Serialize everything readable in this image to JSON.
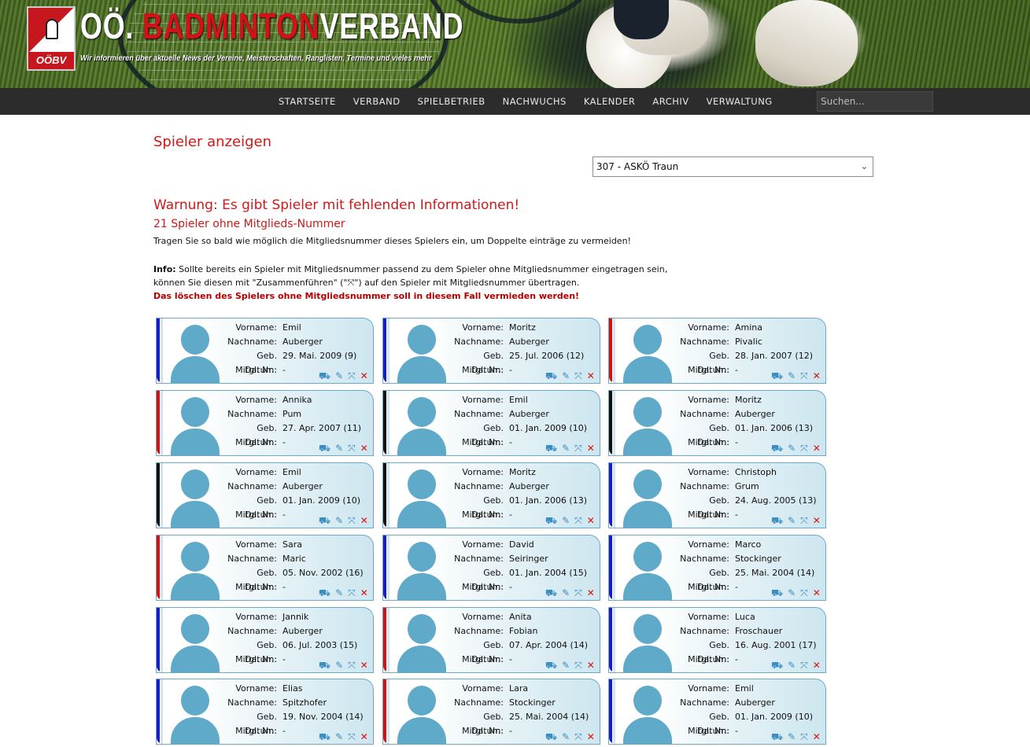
{
  "header": {
    "logo_text": "OÖBV",
    "brand_part1": "OÖ.",
    "brand_part2": "BADMINTON",
    "brand_part3": "VERBAND",
    "tagline": "Wir informieren über aktuelle News der Vereine, Meisterschaften, Ranglisten, Termine und vieles mehr"
  },
  "nav": {
    "items": [
      "STARTSEITE",
      "VERBAND",
      "SPIELBETRIEB",
      "NACHWUCHS",
      "KALENDER",
      "ARCHIV",
      "VERWALTUNG"
    ],
    "search_placeholder": "Suchen..."
  },
  "page": {
    "title": "Spieler anzeigen",
    "club_select": "307 - ASKÖ Traun",
    "warning": "Warnung: Es gibt Spieler mit fehlenden Informationen!",
    "subheading": "21 Spieler ohne Mitglieds-Nummer",
    "hint": "Tragen Sie so bald wie möglich die Mitgliedsnummer dieses Spielers ein, um Doppelte einträge zu vermeiden!",
    "info_label": "Info:",
    "info_line1": " Sollte bereits ein Spieler mit Mitgliedsnummer passend zu dem Spieler ohne Mitgliedsnummer eingetragen sein,",
    "info_line2a": "können Sie diesen mit \"Zusammenführen\" (\"",
    "info_icon": "⤧",
    "info_line2b": "\") auf den Spieler mit Mitgliedsnummer übertragen.",
    "info_warn": "Das löschen des Spielers ohne Mitgliedsnummer soll in diesem Fall vermieden werden!"
  },
  "labels": {
    "vorname": "Vorname:",
    "nachname": "Nachname:",
    "geb": "Geb. Datum:",
    "mitgl": "Mitgl. Nr.:"
  },
  "colors": {
    "male": "#1a1acc",
    "female": "#d41010",
    "unknown": "#111111",
    "accent": "#cc1919"
  },
  "players": [
    {
      "vorname": "Emil",
      "nachname": "Auberger",
      "geb": "29. Mai. 2009 (9)",
      "mitgl": "-",
      "gender": "male"
    },
    {
      "vorname": "Moritz",
      "nachname": "Auberger",
      "geb": "25. Jul. 2006 (12)",
      "mitgl": "-",
      "gender": "male"
    },
    {
      "vorname": "Amina",
      "nachname": "Pivalic",
      "geb": "28. Jan. 2007 (12)",
      "mitgl": "-",
      "gender": "female"
    },
    {
      "vorname": "Annika",
      "nachname": "Pum",
      "geb": "27. Apr. 2007 (11)",
      "mitgl": "-",
      "gender": "female"
    },
    {
      "vorname": "Emil",
      "nachname": "Auberger",
      "geb": "01. Jan. 2009 (10)",
      "mitgl": "-",
      "gender": "unknown"
    },
    {
      "vorname": "Moritz",
      "nachname": "Auberger",
      "geb": "01. Jan. 2006 (13)",
      "mitgl": "-",
      "gender": "unknown"
    },
    {
      "vorname": "Emil",
      "nachname": "Auberger",
      "geb": "01. Jan. 2009 (10)",
      "mitgl": "-",
      "gender": "unknown"
    },
    {
      "vorname": "Moritz",
      "nachname": "Auberger",
      "geb": "01. Jan. 2006 (13)",
      "mitgl": "-",
      "gender": "unknown"
    },
    {
      "vorname": "Christoph",
      "nachname": "Grum",
      "geb": "24. Aug. 2005 (13)",
      "mitgl": "-",
      "gender": "male"
    },
    {
      "vorname": "Sara",
      "nachname": "Maric",
      "geb": "05. Nov. 2002 (16)",
      "mitgl": "-",
      "gender": "female"
    },
    {
      "vorname": "David",
      "nachname": "Seiringer",
      "geb": "01. Jan. 2004 (15)",
      "mitgl": "-",
      "gender": "male"
    },
    {
      "vorname": "Marco",
      "nachname": "Stockinger",
      "geb": "25. Mai. 2004 (14)",
      "mitgl": "-",
      "gender": "male"
    },
    {
      "vorname": "Jannik",
      "nachname": "Auberger",
      "geb": "06. Jul. 2003 (15)",
      "mitgl": "-",
      "gender": "male"
    },
    {
      "vorname": "Anita",
      "nachname": "Fobian",
      "geb": "07. Apr. 2004 (14)",
      "mitgl": "-",
      "gender": "female"
    },
    {
      "vorname": "Luca",
      "nachname": "Froschauer",
      "geb": "16. Aug. 2001 (17)",
      "mitgl": "-",
      "gender": "male"
    },
    {
      "vorname": "Elias",
      "nachname": "Spitzhofer",
      "geb": "19. Nov. 2004 (14)",
      "mitgl": "-",
      "gender": "male"
    },
    {
      "vorname": "Lara",
      "nachname": "Stockinger",
      "geb": "25. Mai. 2004 (14)",
      "mitgl": "-",
      "gender": "female"
    },
    {
      "vorname": "Emil",
      "nachname": "Auberger",
      "geb": "01. Jan. 2009 (10)",
      "mitgl": "-",
      "gender": "male"
    }
  ],
  "actions": {
    "bus_icon": "⛟",
    "edit_icon": "✎",
    "merge_icon": "⤧",
    "delete_icon": "✕"
  }
}
